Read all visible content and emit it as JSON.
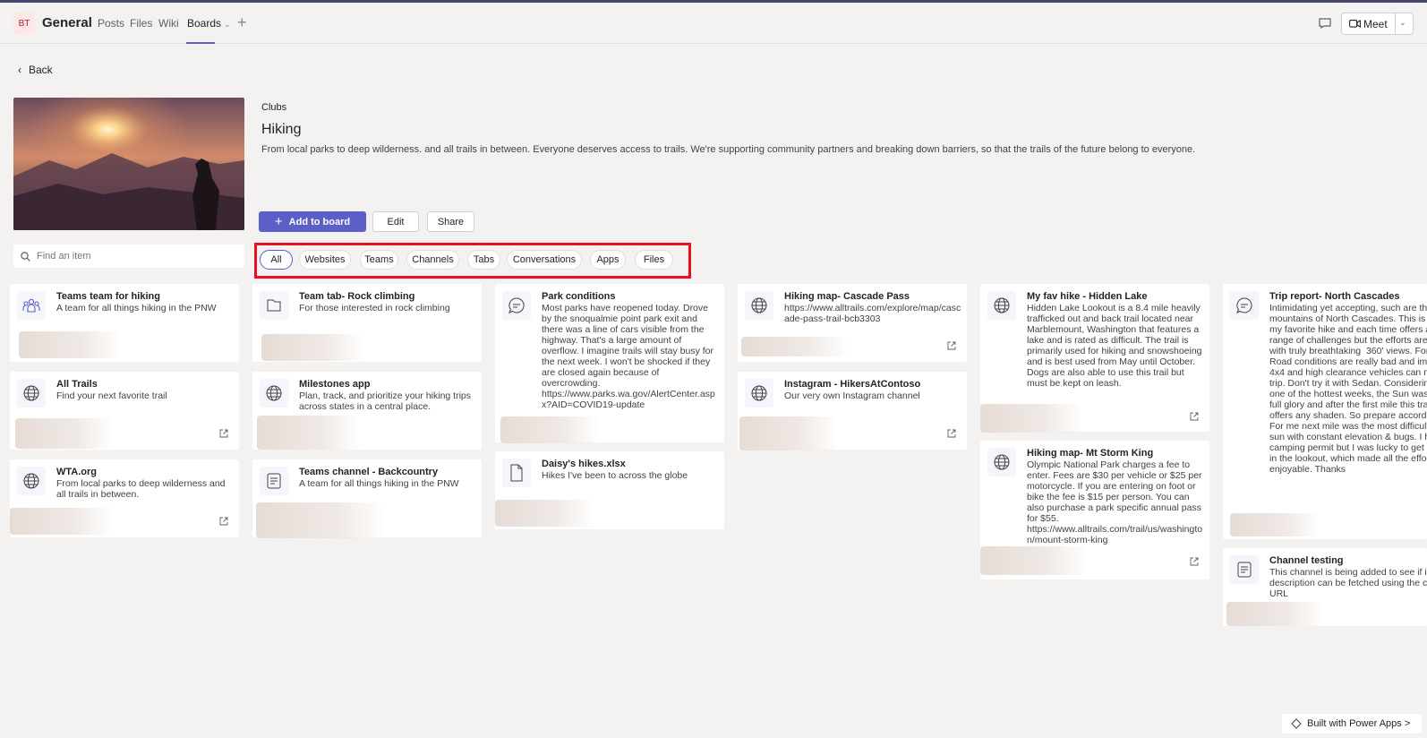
{
  "header": {
    "avatar_initials": "BT",
    "channel_title": "General",
    "tabs": [
      "Posts",
      "Files",
      "Wiki",
      "Boards"
    ],
    "meet_label": "Meet"
  },
  "back_label": "Back",
  "club": {
    "category": "Clubs",
    "name": "Hiking",
    "description": "From local parks to deep wilderness. and all trails in between. Everyone deserves access to trails. We're supporting community partners and breaking down barriers, so that the trails of the future belong to everyone."
  },
  "actions": {
    "add": "Add to board",
    "edit": "Edit",
    "share": "Share"
  },
  "search": {
    "placeholder": "Find an item"
  },
  "filters": [
    "All",
    "Websites",
    "Teams",
    "Channels",
    "Tabs",
    "Conversations",
    "Apps",
    "Files"
  ],
  "cards": [
    {
      "title": "Teams team for hiking",
      "desc": "A team for all things hiking in the PNW",
      "icon": "team-icon"
    },
    {
      "title": "All Trails",
      "desc": "Find your next favorite trail",
      "icon": "globe-icon"
    },
    {
      "title": "WTA.org",
      "desc": "From local parks to deep wilderness and all trails in between.",
      "icon": "globe-icon"
    },
    {
      "title": "Team tab- Rock climbing",
      "desc": "For those interested in rock climbing",
      "icon": "tab-icon"
    },
    {
      "title": "Milestones app",
      "desc": "Plan, track, and prioritize your hiking trips across states in a central place.",
      "icon": "globe-icon"
    },
    {
      "title": "Teams channel - Backcountry",
      "desc": "A team for all things hiking in the PNW",
      "icon": "channel-icon"
    },
    {
      "title": "Park conditions",
      "desc": "Most parks have reopened today. Drove by the snoqualmie point park exit and there was a line of cars visible from the highway. That's a large amount of overflow. I imagine trails will stay busy for the next week. I won't be shocked if they are closed again because of overcrowding. https://www.parks.wa.gov/AlertCenter.aspx?AID=COVID19-update",
      "icon": "conversation-icon"
    },
    {
      "title": "Daisy's hikes.xlsx",
      "desc": "Hikes I've been to across the globe",
      "icon": "file-icon"
    },
    {
      "title": "Hiking map- Cascade Pass",
      "desc": "https://www.alltrails.com/explore/map/cascade-pass-trail-bcb3303",
      "icon": "globe-icon"
    },
    {
      "title": "Instagram - HikersAtContoso",
      "desc": "Our very own Instagram channel",
      "icon": "globe-icon"
    },
    {
      "title": "My fav hike - Hidden Lake",
      "desc": "Hidden Lake Lookout is a 8.4 mile heavily trafficked out and back trail located near Marblemount, Washington that features a lake and is rated as difficult. The trail is primarily used for hiking and snowshoeing and is best used from May until October. Dogs are also able to use this trail but must be kept on leash.",
      "icon": "globe-icon"
    },
    {
      "title": "Hiking map- Mt Storm King",
      "desc": "Olympic National Park charges a fee to enter. Fees are $30 per vehicle or $25 per motorcycle. If you are entering on foot or bike the fee is $15 per person. You can also purchase a park specific annual pass for $55. https://www.alltrails.com/trail/us/washington/mount-storm-king",
      "icon": "globe-icon"
    },
    {
      "title": "Trip report- North Cascades",
      "desc": "Intimidating yet accepting, such are the mountains of North Cascades. This is one of my favorite hike and each time offers a wide range of challenges but the efforts are treated with truly breathtaking  360' views. Forest Road conditions are really bad and imo only 4x4 and high clearance vehicles can make the trip. Don't try it with Sedan. Considering this is one of the hottest weeks, the Sun was in its full glory and after the first mile this trail rarely offers any shaden. So prepare accordingly. For me next mile was the most difficult in the sun with constant elevation & bugs. I had the camping permit but I was lucky to get a space in the lookout, which made all the efforts more enjoyable. Thanks",
      "icon": "conversation-icon"
    },
    {
      "title": "Channel testing",
      "desc": "This channel is being added to see if its description can be fetched using the channel URL",
      "icon": "channel-icon"
    }
  ],
  "footer": {
    "powerapps": "Built with Power Apps >"
  }
}
